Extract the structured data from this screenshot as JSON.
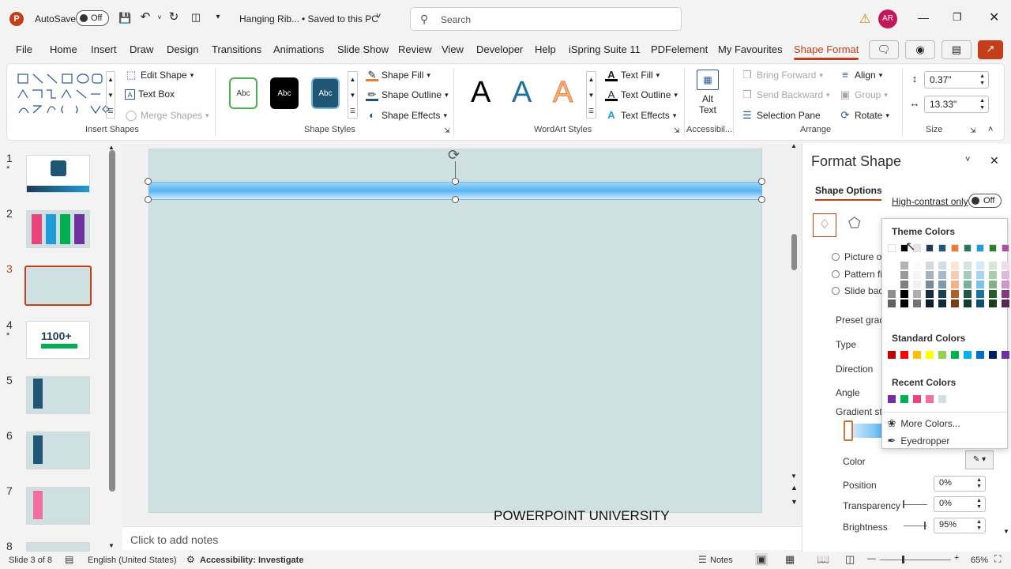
{
  "titlebar": {
    "autosave_label": "AutoSave",
    "autosave_state": "Off",
    "doc_title": "Hanging Rib...",
    "save_status": "• Saved to this PC",
    "search_placeholder": "Search",
    "user_initials": "AR"
  },
  "tabs": [
    "File",
    "Home",
    "Insert",
    "Draw",
    "Design",
    "Transitions",
    "Animations",
    "Slide Show",
    "Review",
    "View",
    "Developer",
    "Help",
    "iSpring Suite 11",
    "PDFelement",
    "My Favourites",
    "Shape Format"
  ],
  "ribbon": {
    "insert_shapes": {
      "edit_shape": "Edit Shape",
      "text_box": "Text Box",
      "merge_shapes": "Merge Shapes",
      "label": "Insert Shapes"
    },
    "shape_styles": {
      "styles": [
        "Abc",
        "Abc",
        "Abc"
      ],
      "fill": "Shape Fill",
      "outline": "Shape Outline",
      "effects": "Shape Effects",
      "label": "Shape Styles"
    },
    "wordart": {
      "letters": [
        "A",
        "A",
        "A"
      ],
      "text_fill": "Text Fill",
      "text_outline": "Text Outline",
      "text_effects": "Text Effects",
      "label": "WordArt Styles"
    },
    "accessibility": {
      "alt_text_1": "Alt",
      "alt_text_2": "Text",
      "label": "Accessibil..."
    },
    "arrange": {
      "bring_forward": "Bring Forward",
      "send_backward": "Send Backward",
      "selection_pane": "Selection Pane",
      "align": "Align",
      "group": "Group",
      "rotate": "Rotate",
      "label": "Arrange"
    },
    "size": {
      "height": "0.37\"",
      "width": "13.33\"",
      "label": "Size"
    }
  },
  "thumbnails": [
    {
      "num": "1",
      "star": "*"
    },
    {
      "num": "2",
      "star": ""
    },
    {
      "num": "3",
      "star": ""
    },
    {
      "num": "4",
      "star": "*",
      "text": "1100+"
    },
    {
      "num": "5",
      "star": ""
    },
    {
      "num": "6",
      "star": ""
    },
    {
      "num": "7",
      "star": ""
    },
    {
      "num": "8",
      "star": ""
    }
  ],
  "slide": {
    "watermark": "POWERPOINT UNIVERSITY"
  },
  "notes_placeholder": "Click to add notes",
  "format_panel": {
    "title": "Format Shape",
    "tab": "Shape Options",
    "fill_options": [
      "Picture or t",
      "Pattern fill",
      "Slide backg"
    ],
    "preset": "Preset gradi",
    "type": "Type",
    "direction": "Direction",
    "angle": "Angle",
    "gradient_stops": "Gradient sto",
    "color": "Color",
    "position_label": "Position",
    "position_value": "0%",
    "transparency_label": "Transparency",
    "transparency_value": "0%",
    "brightness_label": "Brightness",
    "brightness_value": "95%"
  },
  "color_popup": {
    "high_contrast": "High-contrast only",
    "toggle": "Off",
    "theme_colors": "Theme Colors",
    "standard_colors": "Standard Colors",
    "recent_colors": "Recent Colors",
    "more_colors": "More Colors...",
    "eyedropper": "Eyedropper",
    "theme_top": [
      "#ffffff",
      "#000000",
      "#e7e6e6",
      "#1f3b57",
      "#1f5673",
      "#ed7d31",
      "#217a5b",
      "#1f9bd7",
      "#2e7d32",
      "#a94fa6",
      "#4caf50"
    ],
    "standard": [
      "#c00000",
      "#ff0000",
      "#ffc000",
      "#ffff00",
      "#92d050",
      "#00b050",
      "#00b0f0",
      "#0070c0",
      "#002060",
      "#7030a0"
    ],
    "recent": [
      "#7030a0",
      "#00b050",
      "#e7447b",
      "#ef6fa0",
      "#cfe0e2"
    ]
  },
  "status": {
    "slide_of": "Slide 3 of 8",
    "language": "English (United States)",
    "accessibility": "Accessibility: Investigate",
    "notes": "Notes",
    "zoom": "65%"
  }
}
